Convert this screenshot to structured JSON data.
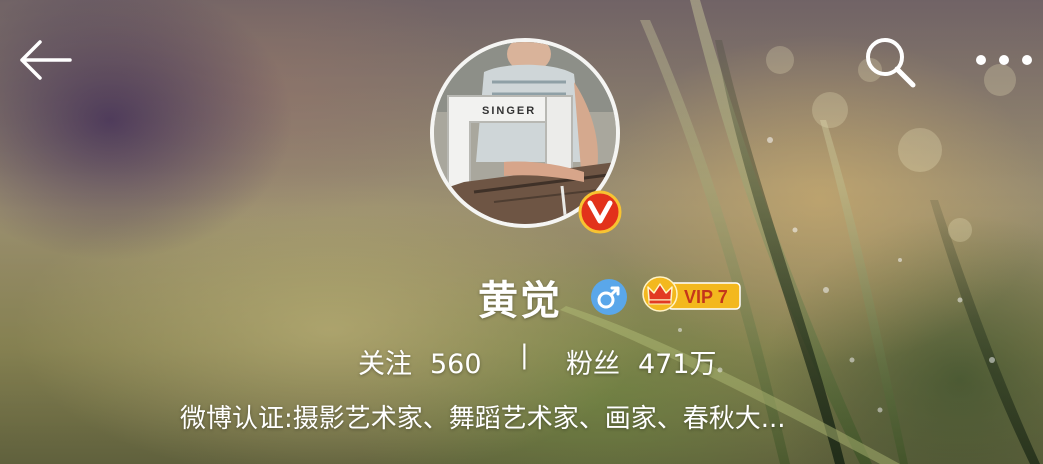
{
  "profile": {
    "username": "黄觉",
    "vip_level": "VIP 7",
    "stats": {
      "following_label": "关注",
      "following_value": "560",
      "separator": "|",
      "fans_label": "粉丝",
      "fans_value": "471万"
    },
    "verification": "微博认证:摄影艺术家、舞蹈艺术家、画家、春秋大..."
  },
  "avatar": {
    "brand_text": "SINGER"
  },
  "icons": {
    "back": "back-arrow-icon",
    "search": "search-icon",
    "more": "more-dots-icon",
    "verified": "verified-v-badge-icon",
    "gender": "male-icon",
    "vip": "crown-icon"
  },
  "colors": {
    "verified_badge": "#e2321b",
    "gender_badge": "#5aa7ea",
    "vip_gold": "#f3b81e",
    "text": "#ffffff"
  }
}
